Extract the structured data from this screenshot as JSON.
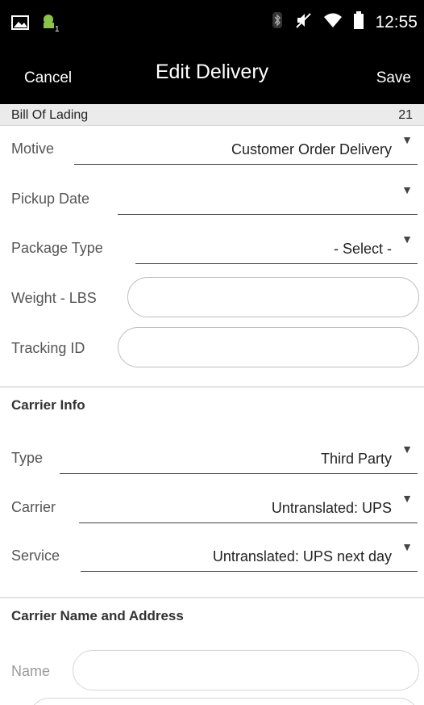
{
  "status_bar": {
    "left_icons": [
      "image-icon",
      "android-notification-icon"
    ],
    "right_icons": [
      "bluetooth-icon",
      "mute-icon",
      "wifi-icon",
      "battery-icon"
    ],
    "time": "12:55"
  },
  "action_bar": {
    "cancel": "Cancel",
    "title": "Edit Delivery",
    "save": "Save"
  },
  "bill_of_lading": {
    "label": "Bill Of Lading",
    "value": "21"
  },
  "fields": {
    "motive": {
      "label": "Motive",
      "value": "Customer Order Delivery"
    },
    "pickup_date": {
      "label": "Pickup Date",
      "value": ""
    },
    "package_type": {
      "label": "Package Type",
      "value": "- Select -"
    },
    "weight": {
      "label": "Weight - LBS",
      "value": ""
    },
    "tracking_id": {
      "label": "Tracking ID",
      "value": ""
    }
  },
  "carrier_info": {
    "heading": "Carrier Info",
    "type": {
      "label": "Type",
      "value": "Third Party"
    },
    "carrier": {
      "label": "Carrier",
      "value": "Untranslated: UPS"
    },
    "service": {
      "label": "Service",
      "value": "Untranslated: UPS next day"
    }
  },
  "carrier_address": {
    "heading": "Carrier Name and Address",
    "name": {
      "label": "Name",
      "value": ""
    }
  },
  "dropdown_glyph": "▼"
}
